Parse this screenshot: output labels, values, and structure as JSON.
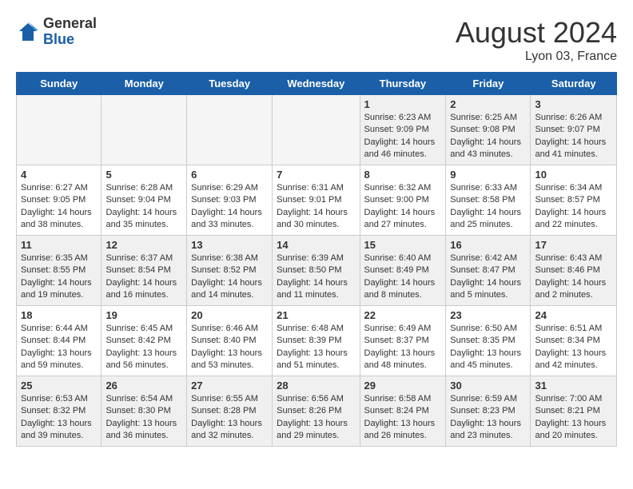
{
  "header": {
    "logo_general": "General",
    "logo_blue": "Blue",
    "month_title": "August 2024",
    "location": "Lyon 03, France"
  },
  "weekdays": [
    "Sunday",
    "Monday",
    "Tuesday",
    "Wednesday",
    "Thursday",
    "Friday",
    "Saturday"
  ],
  "weeks": [
    [
      {
        "day": "",
        "info": "",
        "empty": true
      },
      {
        "day": "",
        "info": "",
        "empty": true
      },
      {
        "day": "",
        "info": "",
        "empty": true
      },
      {
        "day": "",
        "info": "",
        "empty": true
      },
      {
        "day": "1",
        "info": "Sunrise: 6:23 AM\nSunset: 9:09 PM\nDaylight: 14 hours\nand 46 minutes."
      },
      {
        "day": "2",
        "info": "Sunrise: 6:25 AM\nSunset: 9:08 PM\nDaylight: 14 hours\nand 43 minutes."
      },
      {
        "day": "3",
        "info": "Sunrise: 6:26 AM\nSunset: 9:07 PM\nDaylight: 14 hours\nand 41 minutes."
      }
    ],
    [
      {
        "day": "4",
        "info": "Sunrise: 6:27 AM\nSunset: 9:05 PM\nDaylight: 14 hours\nand 38 minutes."
      },
      {
        "day": "5",
        "info": "Sunrise: 6:28 AM\nSunset: 9:04 PM\nDaylight: 14 hours\nand 35 minutes."
      },
      {
        "day": "6",
        "info": "Sunrise: 6:29 AM\nSunset: 9:03 PM\nDaylight: 14 hours\nand 33 minutes."
      },
      {
        "day": "7",
        "info": "Sunrise: 6:31 AM\nSunset: 9:01 PM\nDaylight: 14 hours\nand 30 minutes."
      },
      {
        "day": "8",
        "info": "Sunrise: 6:32 AM\nSunset: 9:00 PM\nDaylight: 14 hours\nand 27 minutes."
      },
      {
        "day": "9",
        "info": "Sunrise: 6:33 AM\nSunset: 8:58 PM\nDaylight: 14 hours\nand 25 minutes."
      },
      {
        "day": "10",
        "info": "Sunrise: 6:34 AM\nSunset: 8:57 PM\nDaylight: 14 hours\nand 22 minutes."
      }
    ],
    [
      {
        "day": "11",
        "info": "Sunrise: 6:35 AM\nSunset: 8:55 PM\nDaylight: 14 hours\nand 19 minutes."
      },
      {
        "day": "12",
        "info": "Sunrise: 6:37 AM\nSunset: 8:54 PM\nDaylight: 14 hours\nand 16 minutes."
      },
      {
        "day": "13",
        "info": "Sunrise: 6:38 AM\nSunset: 8:52 PM\nDaylight: 14 hours\nand 14 minutes."
      },
      {
        "day": "14",
        "info": "Sunrise: 6:39 AM\nSunset: 8:50 PM\nDaylight: 14 hours\nand 11 minutes."
      },
      {
        "day": "15",
        "info": "Sunrise: 6:40 AM\nSunset: 8:49 PM\nDaylight: 14 hours\nand 8 minutes."
      },
      {
        "day": "16",
        "info": "Sunrise: 6:42 AM\nSunset: 8:47 PM\nDaylight: 14 hours\nand 5 minutes."
      },
      {
        "day": "17",
        "info": "Sunrise: 6:43 AM\nSunset: 8:46 PM\nDaylight: 14 hours\nand 2 minutes."
      }
    ],
    [
      {
        "day": "18",
        "info": "Sunrise: 6:44 AM\nSunset: 8:44 PM\nDaylight: 13 hours\nand 59 minutes."
      },
      {
        "day": "19",
        "info": "Sunrise: 6:45 AM\nSunset: 8:42 PM\nDaylight: 13 hours\nand 56 minutes."
      },
      {
        "day": "20",
        "info": "Sunrise: 6:46 AM\nSunset: 8:40 PM\nDaylight: 13 hours\nand 53 minutes."
      },
      {
        "day": "21",
        "info": "Sunrise: 6:48 AM\nSunset: 8:39 PM\nDaylight: 13 hours\nand 51 minutes."
      },
      {
        "day": "22",
        "info": "Sunrise: 6:49 AM\nSunset: 8:37 PM\nDaylight: 13 hours\nand 48 minutes."
      },
      {
        "day": "23",
        "info": "Sunrise: 6:50 AM\nSunset: 8:35 PM\nDaylight: 13 hours\nand 45 minutes."
      },
      {
        "day": "24",
        "info": "Sunrise: 6:51 AM\nSunset: 8:34 PM\nDaylight: 13 hours\nand 42 minutes."
      }
    ],
    [
      {
        "day": "25",
        "info": "Sunrise: 6:53 AM\nSunset: 8:32 PM\nDaylight: 13 hours\nand 39 minutes."
      },
      {
        "day": "26",
        "info": "Sunrise: 6:54 AM\nSunset: 8:30 PM\nDaylight: 13 hours\nand 36 minutes."
      },
      {
        "day": "27",
        "info": "Sunrise: 6:55 AM\nSunset: 8:28 PM\nDaylight: 13 hours\nand 32 minutes."
      },
      {
        "day": "28",
        "info": "Sunrise: 6:56 AM\nSunset: 8:26 PM\nDaylight: 13 hours\nand 29 minutes."
      },
      {
        "day": "29",
        "info": "Sunrise: 6:58 AM\nSunset: 8:24 PM\nDaylight: 13 hours\nand 26 minutes."
      },
      {
        "day": "30",
        "info": "Sunrise: 6:59 AM\nSunset: 8:23 PM\nDaylight: 13 hours\nand 23 minutes."
      },
      {
        "day": "31",
        "info": "Sunrise: 7:00 AM\nSunset: 8:21 PM\nDaylight: 13 hours\nand 20 minutes."
      }
    ]
  ]
}
